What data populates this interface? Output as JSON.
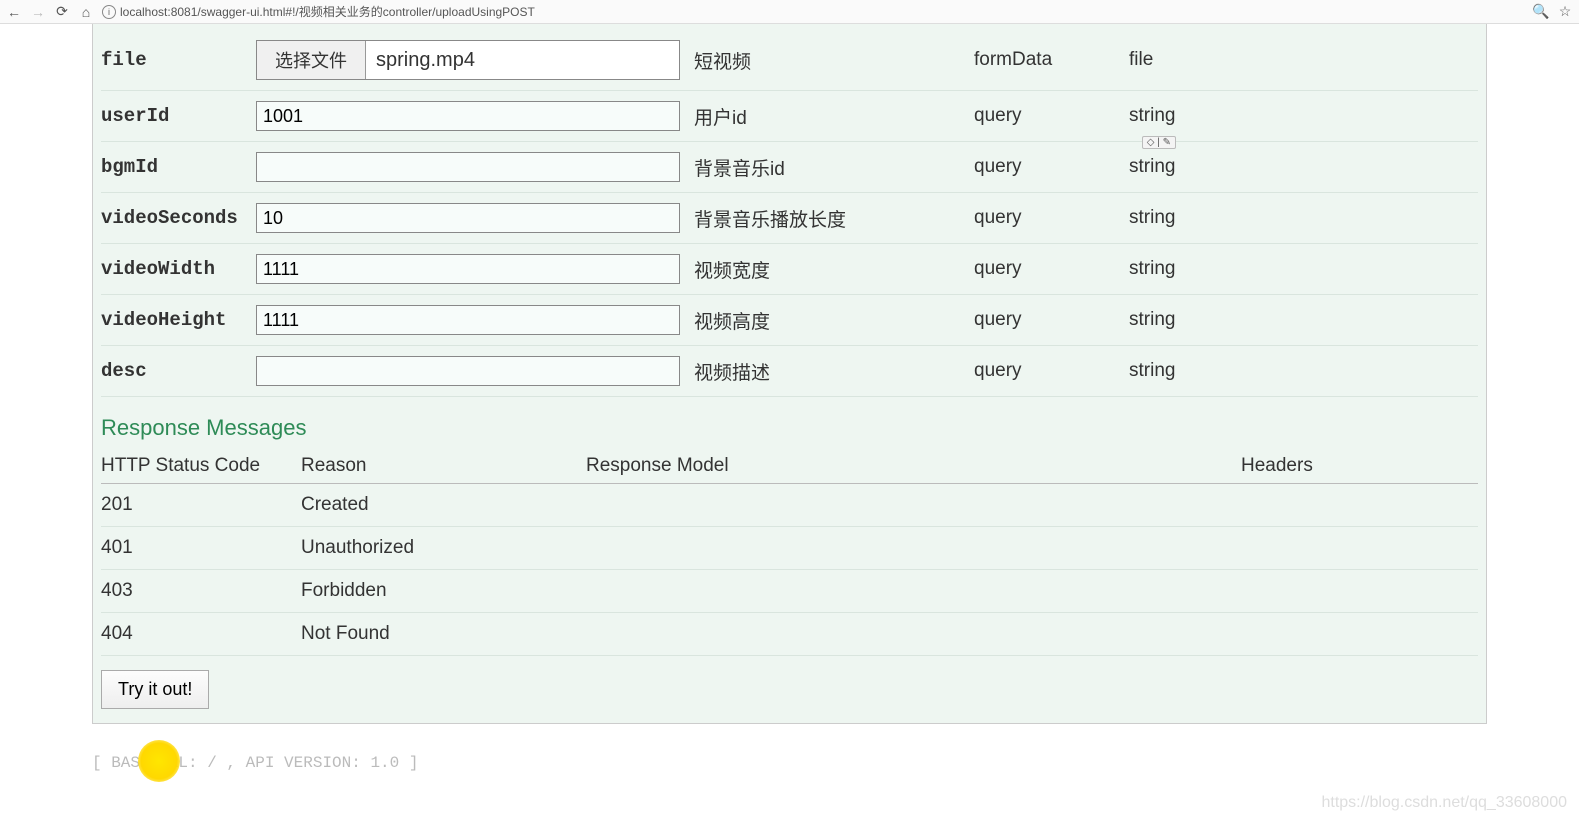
{
  "chrome": {
    "url": "localhost:8081/swagger-ui.html#!/视频相关业务的controller/uploadUsingPOST"
  },
  "params": [
    {
      "name": "file",
      "fileButton": "选择文件",
      "fileName": "spring.mp4",
      "desc": "短视频",
      "paramType": "formData",
      "dataType": "file",
      "isFile": true
    },
    {
      "name": "userId",
      "value": "1001",
      "desc": "用户id",
      "paramType": "query",
      "dataType": "string"
    },
    {
      "name": "bgmId",
      "value": "",
      "desc": "背景音乐id",
      "paramType": "query",
      "dataType": "string"
    },
    {
      "name": "videoSeconds",
      "value": "10",
      "desc": "背景音乐播放长度",
      "paramType": "query",
      "dataType": "string"
    },
    {
      "name": "videoWidth",
      "value": "1111",
      "desc": "视频宽度",
      "paramType": "query",
      "dataType": "string"
    },
    {
      "name": "videoHeight",
      "value": "1111",
      "desc": "视频高度",
      "paramType": "query",
      "dataType": "string"
    },
    {
      "name": "desc",
      "value": "",
      "desc": "视频描述",
      "paramType": "query",
      "dataType": "string"
    }
  ],
  "responseHeading": "Response Messages",
  "responseColumns": [
    "HTTP Status Code",
    "Reason",
    "Response Model",
    "Headers"
  ],
  "responses": [
    {
      "code": "201",
      "reason": "Created"
    },
    {
      "code": "401",
      "reason": "Unauthorized"
    },
    {
      "code": "403",
      "reason": "Forbidden"
    },
    {
      "code": "404",
      "reason": "Not Found"
    }
  ],
  "tryLabel": "Try it out!",
  "badge": "◇ | ✎",
  "footer": "[ BASE URL: / , API VERSION: 1.0 ]",
  "watermark": "https://blog.csdn.net/qq_33608000"
}
